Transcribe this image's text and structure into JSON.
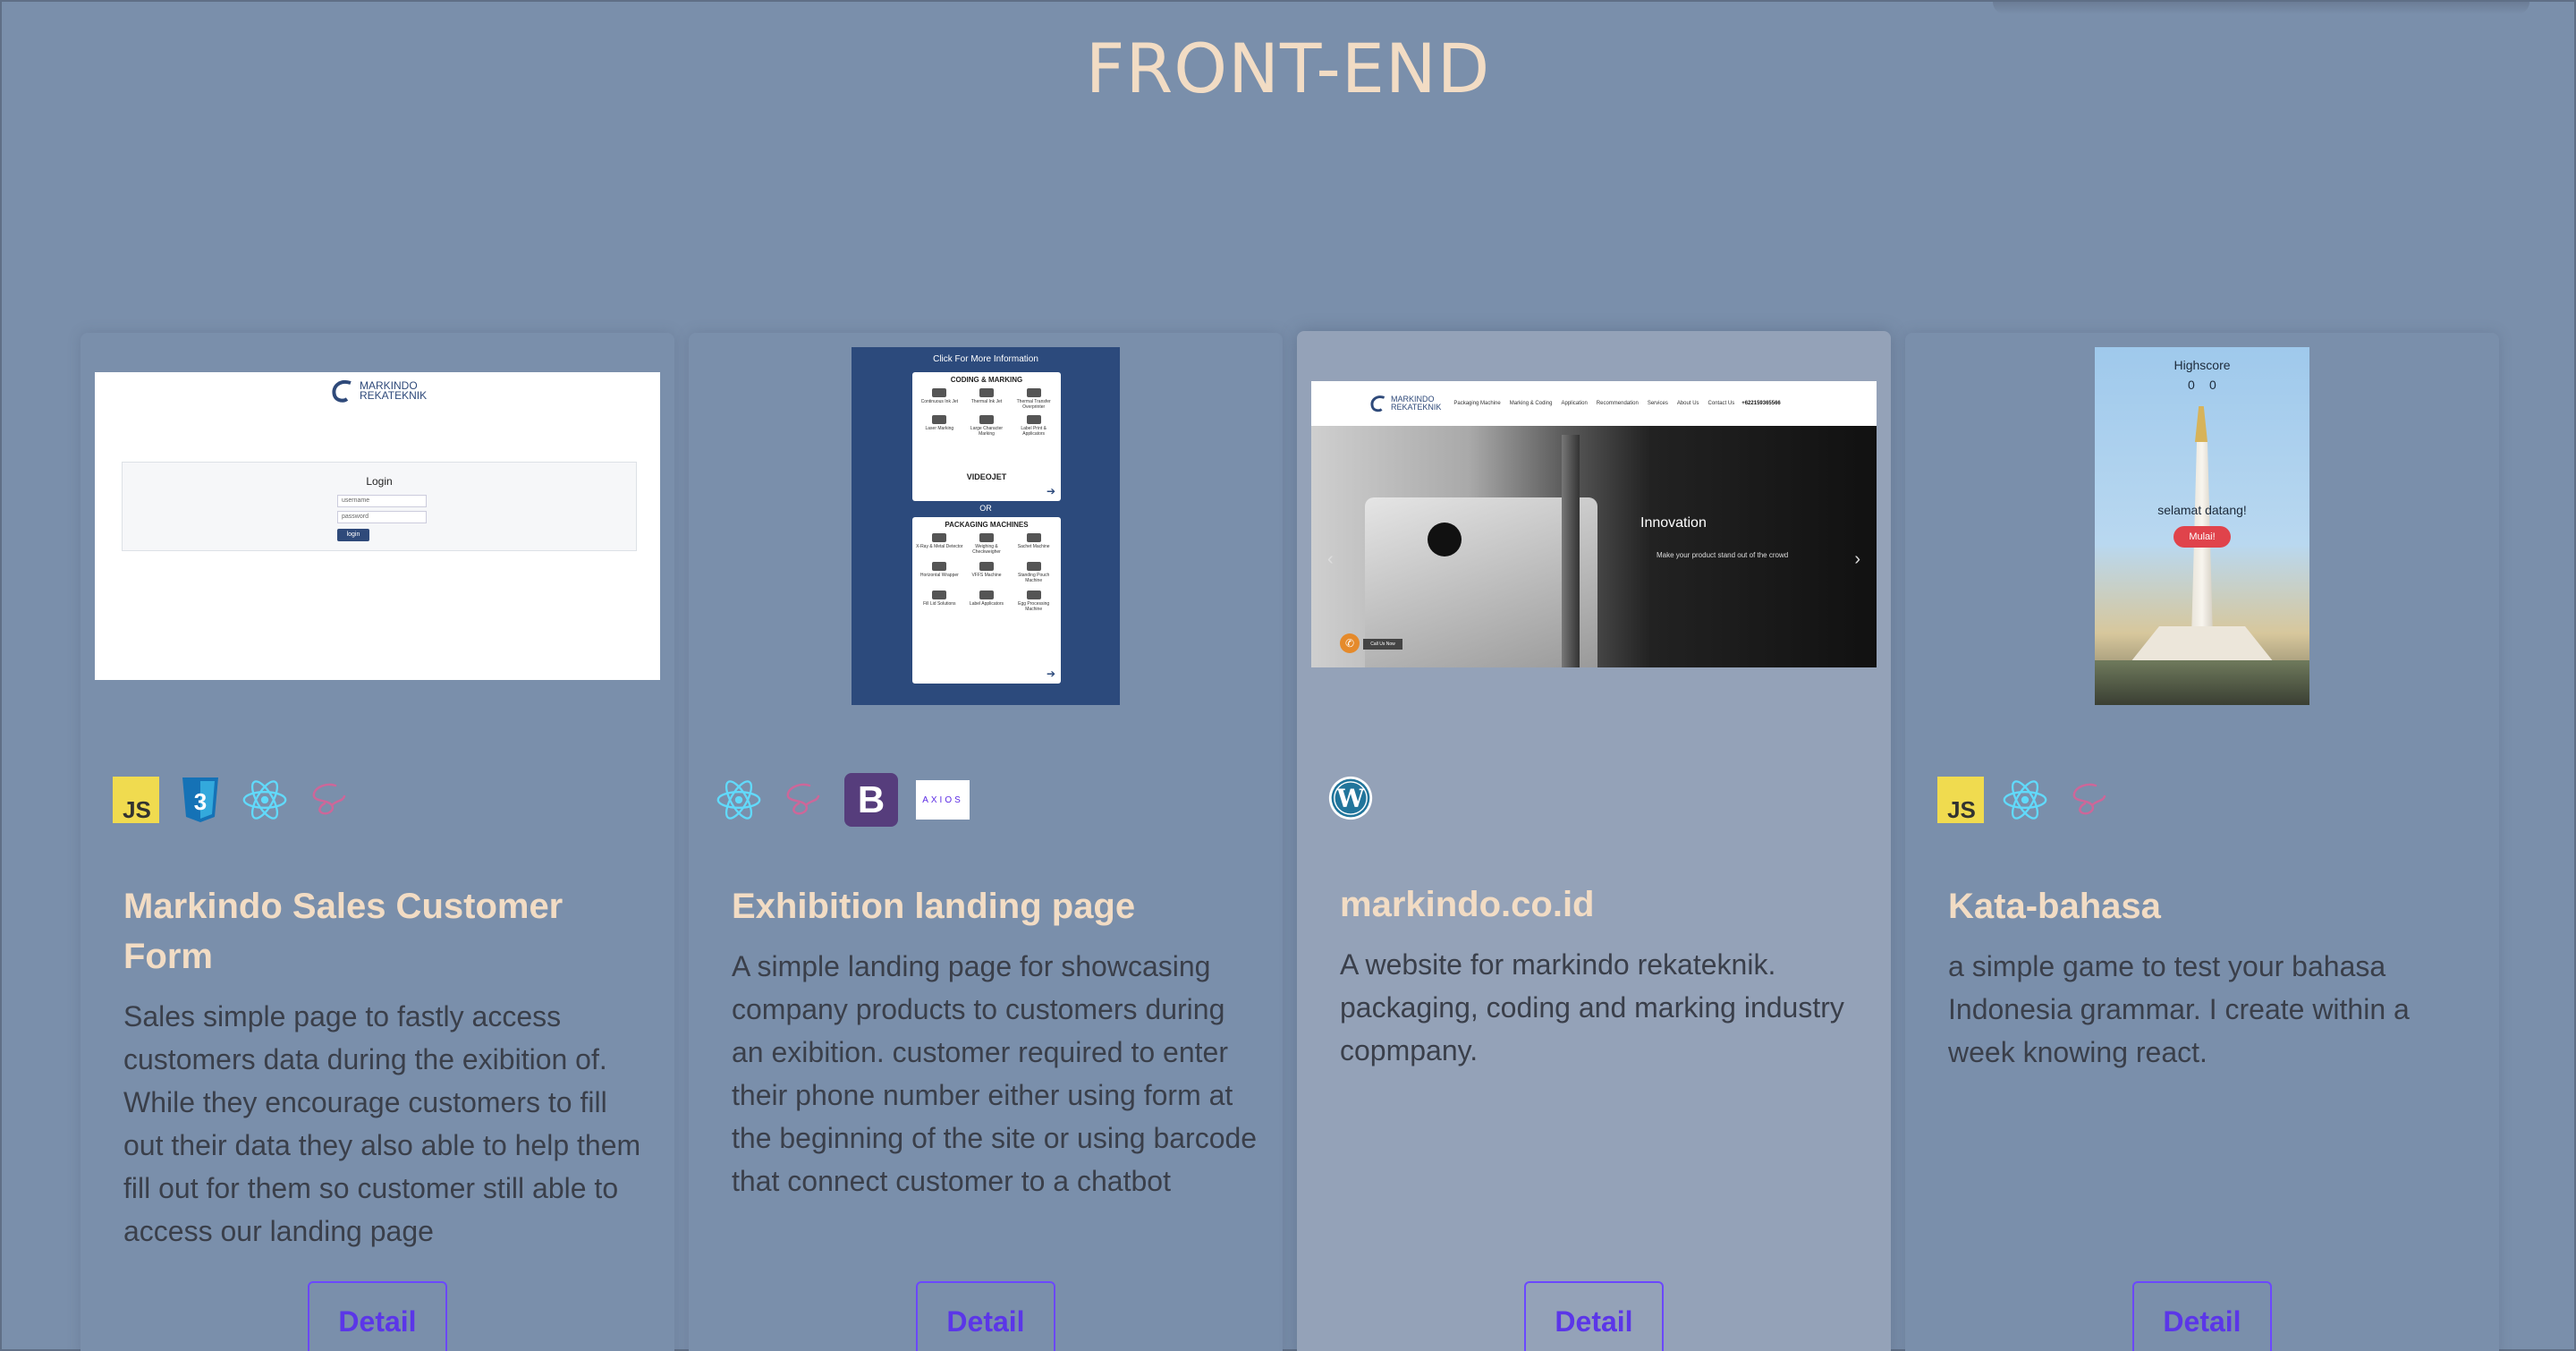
{
  "section_title": "FRONT-END",
  "cards": [
    {
      "title": "Markindo Sales Customer Form",
      "description": "Sales simple page to fastly access customers data during the exibition of. While they encourage customers to fill out their data they also able to help them fill out for them so customer still able to access our landing page",
      "button": "Detail",
      "tech": [
        "javascript-icon",
        "css3-icon",
        "react-icon",
        "sass-icon"
      ],
      "thumb": {
        "logo_line1": "MARKINDO",
        "logo_line2": "REKATEKNIK",
        "login_title": "Login",
        "username_placeholder": "username",
        "password_placeholder": "password",
        "login_button": "login"
      }
    },
    {
      "title": "Exhibition landing page",
      "description": "A simple landing page for showcasing company products to customers during an exibition. customer required to enter their phone number either using form at the beginning of the site or using barcode that connect customer to a chatbot",
      "button": "Detail",
      "tech": [
        "react-icon",
        "sass-icon",
        "bootstrap-icon",
        "axios-icon"
      ],
      "tech_labels": {
        "bootstrap": "B",
        "axios": "AXIOS"
      },
      "thumb": {
        "header": "Click For More Information",
        "section1": "CODING & MARKING",
        "items1": [
          "Continuous Ink Jet",
          "Thermal Ink Jet",
          "Thermal Transfer Overprinter",
          "Laser Marking",
          "Large Character Marking",
          "Label Print & Applicators"
        ],
        "brand1": "VIDEOJET",
        "or": "OR",
        "section2": "PACKAGING MACHINES",
        "items2": [
          "X-Ray & Metal Detector",
          "Weighing & Checkweigher",
          "Sachet Machine",
          "Horizontal Wrapper",
          "VFFS Machine",
          "Standing Pouch Machine",
          "Fill Lid Solutions",
          "Label Applicators",
          "Egg Processing Machine"
        ]
      }
    },
    {
      "title": "markindo.co.id",
      "description": "A website for markindo rekateknik. packaging, coding and marking industry copmpany.",
      "button": "Detail",
      "tech": [
        "wordpress-icon"
      ],
      "thumb": {
        "logo_line1": "MARKINDO",
        "logo_line2": "REKATEKNIK",
        "nav": [
          "Packaging Machine",
          "Marking & Coding",
          "Application",
          "Recommendation",
          "Services",
          "About Us",
          "Contact Us"
        ],
        "phone": "+622159365566",
        "hero_title": "Innovation",
        "hero_sub": "Make your product stand out of the crowd",
        "call_label": "Call Us Now"
      }
    },
    {
      "title": "Kata-bahasa",
      "description": "a simple game to test your bahasa Indonesia grammar. I create within a week knowing react.",
      "button": "Detail",
      "tech": [
        "javascript-icon",
        "react-icon",
        "sass-icon"
      ],
      "thumb": {
        "highscore_label": "Highscore",
        "score_left": "0",
        "score_right": "0",
        "welcome": "selamat datang!",
        "start_button": "Mulai!"
      }
    }
  ],
  "colors": {
    "background": "#7a8fab",
    "active_card": "#94a2b8",
    "title": "#f2dcc4",
    "button_accent": "#6b48ff"
  }
}
